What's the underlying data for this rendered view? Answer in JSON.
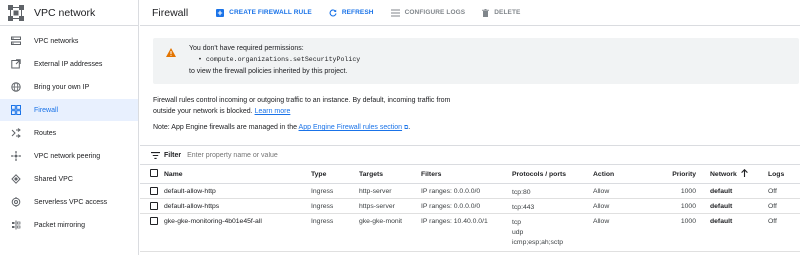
{
  "sidebar": {
    "title": "VPC network",
    "items": [
      {
        "label": "VPC networks",
        "icon": "vpc-networks-icon",
        "active": false
      },
      {
        "label": "External IP addresses",
        "icon": "external-ip-icon",
        "active": false
      },
      {
        "label": "Bring your own IP",
        "icon": "byoip-globe-icon",
        "active": false
      },
      {
        "label": "Firewall",
        "icon": "firewall-icon",
        "active": true
      },
      {
        "label": "Routes",
        "icon": "routes-icon",
        "active": false
      },
      {
        "label": "VPC network peering",
        "icon": "peering-icon",
        "active": false
      },
      {
        "label": "Shared VPC",
        "icon": "shared-vpc-icon",
        "active": false
      },
      {
        "label": "Serverless VPC access",
        "icon": "serverless-icon",
        "active": false
      },
      {
        "label": "Packet mirroring",
        "icon": "packet-mirroring-icon",
        "active": false
      }
    ]
  },
  "header": {
    "title": "Firewall",
    "create_label": "CREATE FIREWALL RULE",
    "refresh_label": "REFRESH",
    "configure_label": "CONFIGURE LOGS",
    "delete_label": "DELETE"
  },
  "warning": {
    "line1": "You don't have required permissions:",
    "line2": "• compute.organizations.setSecurityPolicy",
    "line3": "to view the firewall policies inherited by this project."
  },
  "description": {
    "text": "Firewall rules control incoming or outgoing traffic to an instance. By default, incoming traffic from outside your network is blocked.",
    "link": "Learn more"
  },
  "note": {
    "prefix": "Note: App Engine firewalls are managed in the",
    "link": "App Engine Firewall rules section",
    "suffix": "."
  },
  "filter": {
    "label": "Filter",
    "placeholder": "Enter property name or value"
  },
  "table": {
    "headers": {
      "name": "Name",
      "type": "Type",
      "targets": "Targets",
      "filters": "Filters",
      "protocols": "Protocols / ports",
      "action": "Action",
      "priority": "Priority",
      "network": "Network",
      "logs": "Logs"
    },
    "rows": [
      {
        "name": "default-allow-http",
        "type": "Ingress",
        "targets": "http-server",
        "filters": "IP ranges: 0.0.0.0/0",
        "protocols": [
          "tcp:80"
        ],
        "action": "Allow",
        "priority": "1000",
        "network": "default",
        "logs": "Off"
      },
      {
        "name": "default-allow-https",
        "type": "Ingress",
        "targets": "https-server",
        "filters": "IP ranges: 0.0.0.0/0",
        "protocols": [
          "tcp:443"
        ],
        "action": "Allow",
        "priority": "1000",
        "network": "default",
        "logs": "Off"
      },
      {
        "name": "gke-gke-monitoring-4b01e45f-all",
        "type": "Ingress",
        "targets": "gke-gke-monit",
        "filters": "IP ranges: 10.40.0.0/1",
        "protocols": [
          "tcp",
          "udp",
          "icmp;esp;ah;sctp"
        ],
        "action": "Allow",
        "priority": "1000",
        "network": "default",
        "logs": "Off"
      }
    ]
  },
  "colors": {
    "accent": "#1a73e8",
    "active_bg": "#e8f0fe",
    "warning_icon": "#e37400",
    "warning_bg": "#f1f3f4"
  }
}
